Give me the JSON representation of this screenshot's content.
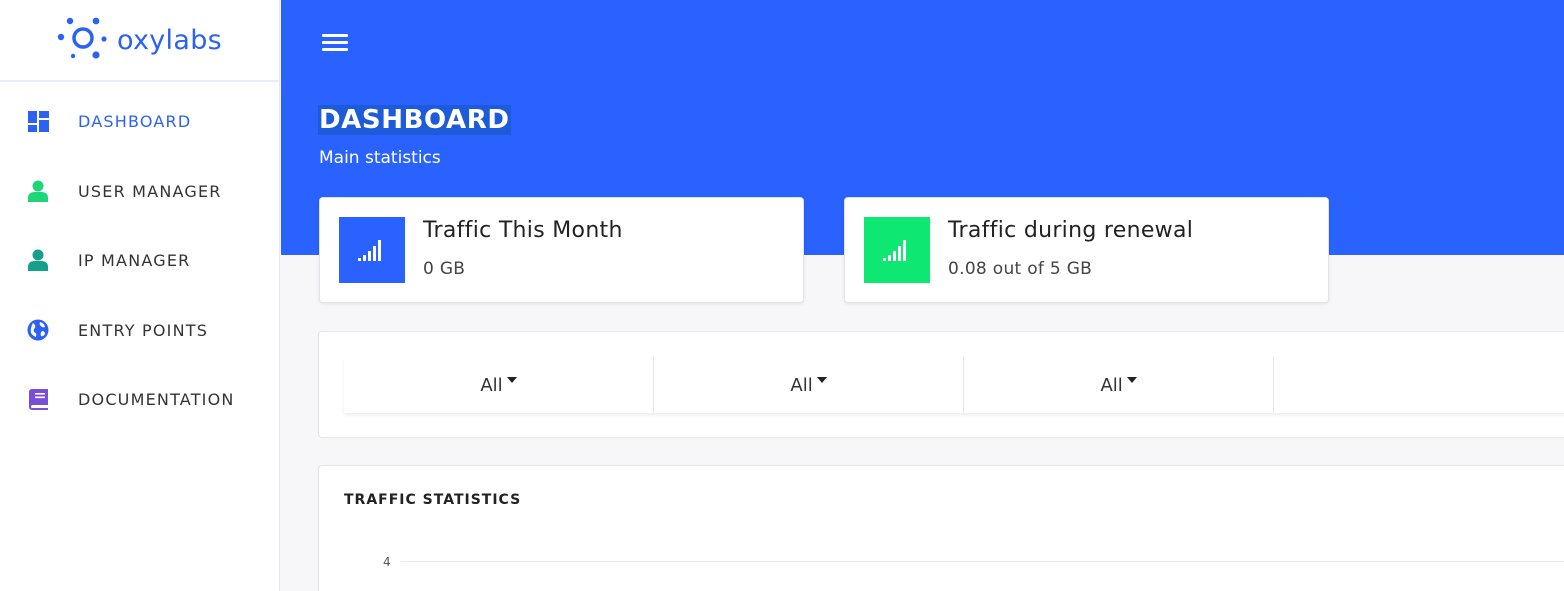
{
  "logo": {
    "text": "oxylabs"
  },
  "sidebar": {
    "items": [
      {
        "label": "DASHBOARD",
        "icon": "dashboard-icon",
        "color": "#2b62f1",
        "active": true
      },
      {
        "label": "USER MANAGER",
        "icon": "user-icon",
        "color": "#1ed67a",
        "active": false
      },
      {
        "label": "IP MANAGER",
        "icon": "user-icon",
        "color": "#14a08a",
        "active": false
      },
      {
        "label": "ENTRY POINTS",
        "icon": "globe-icon",
        "color": "#2b62f1",
        "active": false
      },
      {
        "label": "DOCUMENTATION",
        "icon": "book-icon",
        "color": "#7a4fd8",
        "active": false
      }
    ]
  },
  "header": {
    "title": "DASHBOARD",
    "subtitle": "Main statistics",
    "background": "#2962ff"
  },
  "stats": [
    {
      "title": "Traffic This Month",
      "value": "0 GB",
      "icon": "signal-bars-icon",
      "color": "#2962ff"
    },
    {
      "title": "Traffic during renewal",
      "value": "0.08 out of 5 GB",
      "icon": "signal-bars-icon",
      "color": "#0ee872"
    }
  ],
  "filters": [
    {
      "value": "All"
    },
    {
      "value": "All"
    },
    {
      "value": "All"
    },
    {
      "value": ""
    }
  ],
  "chart": {
    "title": "TRAFFIC STATISTICS",
    "y_tick_top": "4"
  }
}
